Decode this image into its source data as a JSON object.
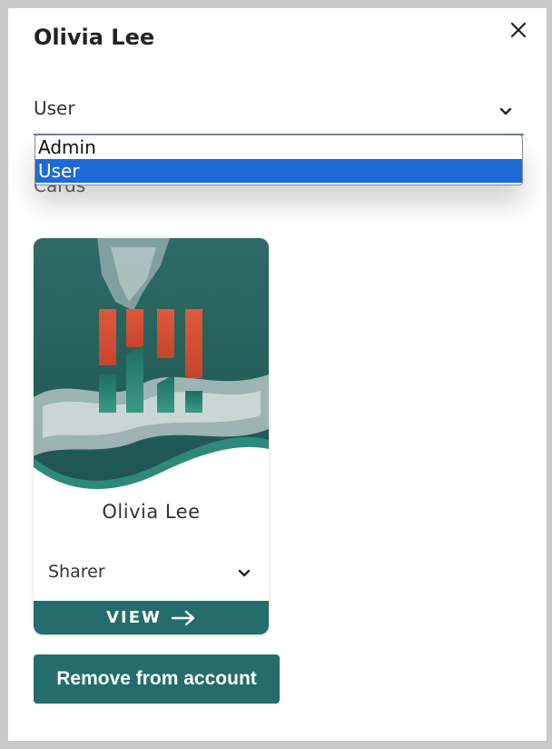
{
  "header": {
    "title": "Olivia Lee"
  },
  "role_select": {
    "value": "User",
    "options": [
      "Admin",
      "User"
    ],
    "selected_index": 1
  },
  "cards_section": {
    "label": "Cards"
  },
  "card": {
    "name": "Olivia Lee",
    "role_value": "Sharer",
    "view_label": "VIEW"
  },
  "actions": {
    "remove_label": "Remove from account"
  },
  "colors": {
    "accent": "#256c6c",
    "selected_option": "#1d6ad8",
    "logo_orange": "#d9553a",
    "logo_teal": "#2e8a78"
  },
  "icons": {
    "close": "close-icon",
    "chevron": "chevron-down-icon",
    "arrow": "arrow-right-icon"
  }
}
